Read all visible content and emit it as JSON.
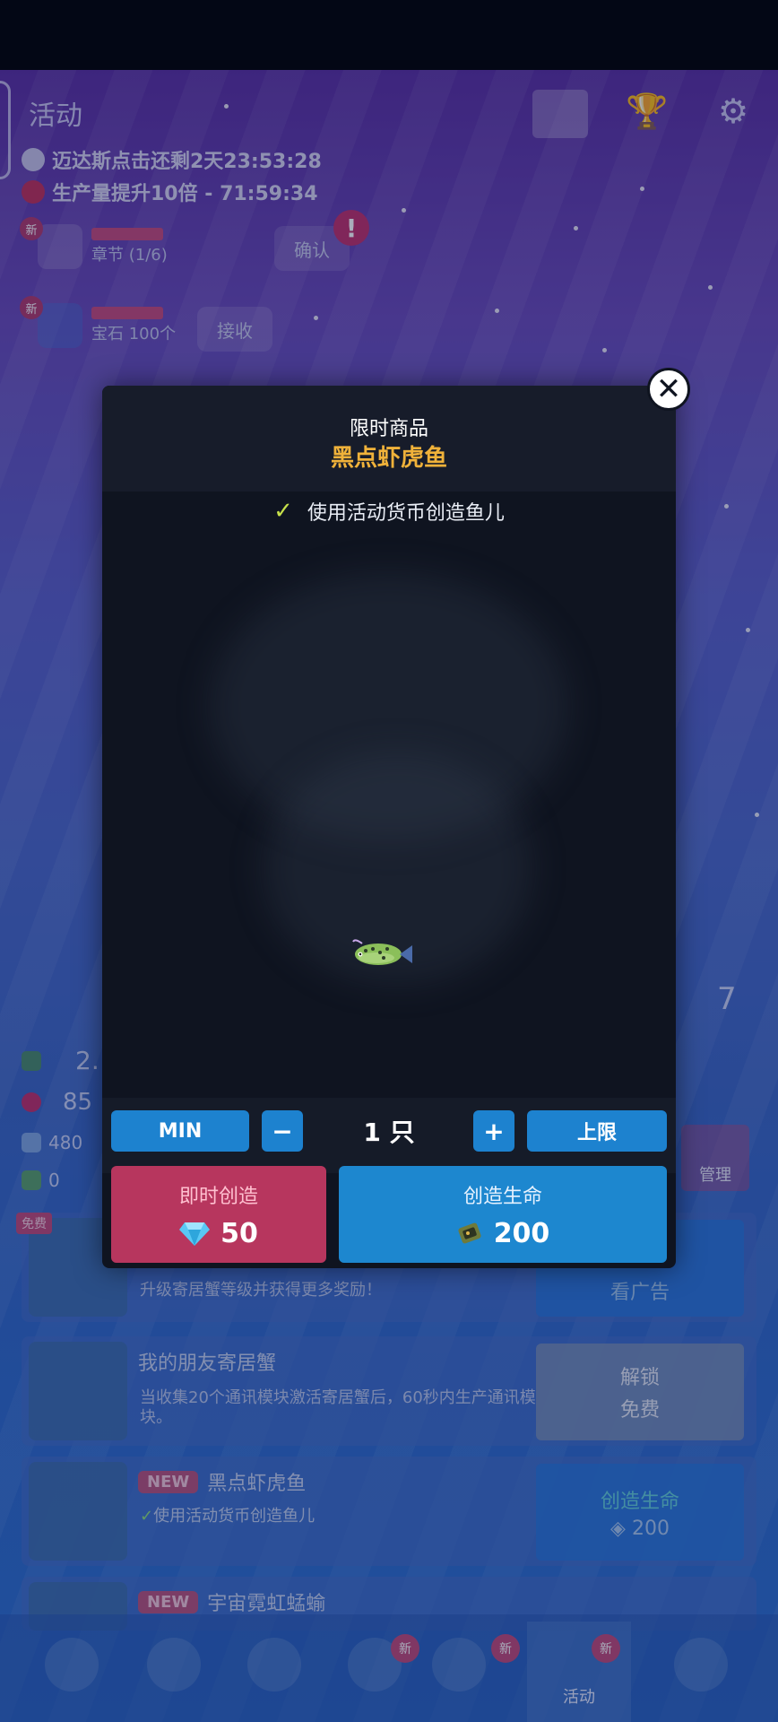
{
  "top_panel": {
    "title": "活动",
    "timers": [
      "迈达斯点击还剩2天23:53:28",
      "生产量提升10倍 - 71:59:34"
    ],
    "notices": [
      {
        "badge": "新",
        "sub": "章节 (1/6)",
        "button": "确认"
      },
      {
        "badge": "新",
        "sub": "宝石 100个",
        "button": "接收"
      }
    ]
  },
  "left_stats": [
    {
      "value": "2."
    },
    {
      "value": "85"
    },
    {
      "value": "480"
    },
    {
      "value": "0"
    }
  ],
  "side_labels": {
    "season_number": "7",
    "manage": "管理"
  },
  "modal": {
    "subtitle": "限时商品",
    "title": "黑点虾虎鱼",
    "check_text": "使用活动货币创造鱼儿",
    "min_label": "MIN",
    "minus_label": "−",
    "quantity": "1 只",
    "plus_label": "+",
    "max_label": "上限",
    "instant": {
      "label": "即时创造",
      "cost": "50"
    },
    "create": {
      "label": "创造生命",
      "cost": "200"
    },
    "colors": {
      "title": "#f0b23a",
      "instant_bg": "#b7365e",
      "create_bg": "#1d87cf"
    }
  },
  "list": {
    "row0": {
      "desc": "升级寄居蟹等级并获得更多奖励！",
      "button": "看广告",
      "tag": "免费"
    },
    "row1": {
      "title": "我的朋友寄居蟹",
      "desc": "当收集20个通讯模块激活寄居蟹后，60秒内生产通讯模块。",
      "button_line1": "解锁",
      "button_line2": "免费"
    },
    "row2": {
      "new": "NEW",
      "title": "黑点虾虎鱼",
      "desc": "使用活动货币创造鱼儿",
      "button": "创造生命",
      "cost": "200"
    },
    "row3": {
      "new": "NEW",
      "title": "宇宙霓虹蜢蝓"
    }
  },
  "tabbar": {
    "active_label": "活动",
    "badges": [
      "新",
      "新",
      "新"
    ]
  }
}
